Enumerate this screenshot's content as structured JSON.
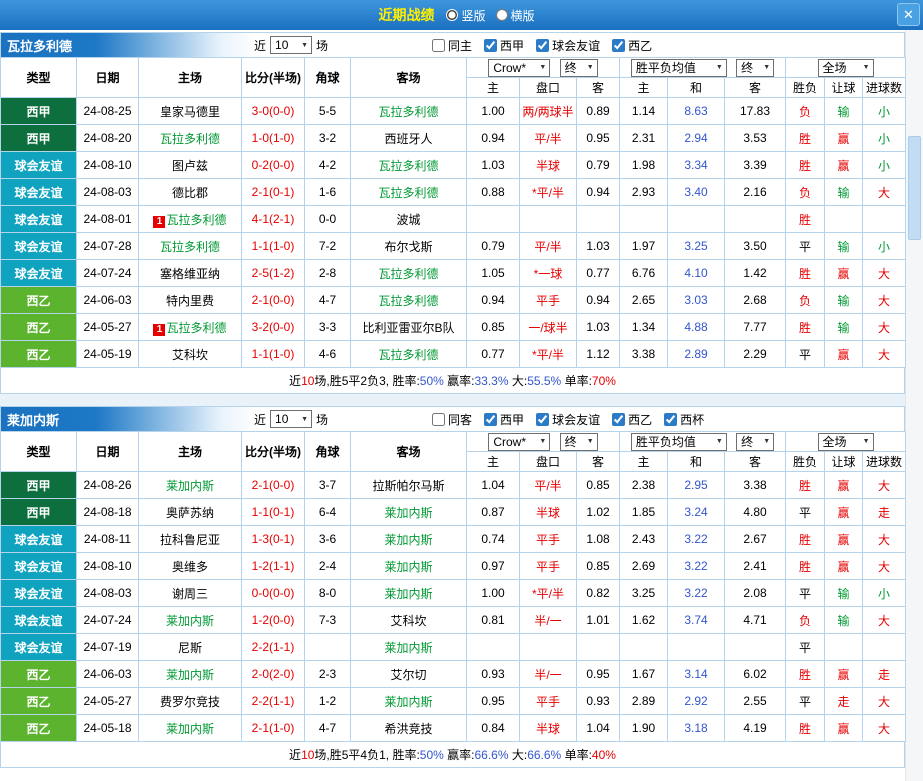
{
  "topbar": {
    "title": "近期战绩",
    "vertical": "竖版",
    "horizontal": "横版",
    "close": "✕"
  },
  "colors": {
    "score_red": "#e60000",
    "focus_green": "#009933",
    "draw_blue": "#3355cc",
    "liga_bg": "#0e6f3e",
    "friendly_bg": "#0fa3c0",
    "segunda_bg": "#5cb32e",
    "bar_blue": "#1b6fc0"
  },
  "headers": {
    "type": "类型",
    "date": "日期",
    "home": "主场",
    "score": "比分(半场)",
    "corner": "角球",
    "away": "客场",
    "h": "主",
    "line": "盘口",
    "a": "客",
    "draw": "和",
    "res": "胜负",
    "han": "让球",
    "goals": "进球数"
  },
  "sections": [
    {
      "team": "瓦拉多利德",
      "near_label": "近",
      "near_value": "10",
      "games_label": "场",
      "same_label": "同主",
      "leagues": [
        "西甲",
        "球会友谊",
        "西乙"
      ],
      "odds_dd": "Crow*",
      "end_dd": "终",
      "avg_dd": "胜平负均值",
      "scope_dd": "全场",
      "rows": [
        {
          "lg": "西甲",
          "lgc": "liga",
          "date": "24-08-25",
          "home": "皇家马德里",
          "score": "3-0(0-0)",
          "corner": "5-5",
          "away": "瓦拉多利德",
          "af": true,
          "o": [
            "1.00",
            "两/两球半",
            "0.89"
          ],
          "a": [
            "1.14",
            "8.63",
            "17.83"
          ],
          "res": [
            "负",
            "r"
          ],
          "han": [
            "输",
            "g"
          ],
          "goal": [
            "小",
            "g"
          ]
        },
        {
          "lg": "西甲",
          "lgc": "liga",
          "date": "24-08-20",
          "home": "瓦拉多利德",
          "hf": true,
          "score": "1-0(1-0)",
          "corner": "3-2",
          "away": "西班牙人",
          "o": [
            "0.94",
            "平/半",
            "0.95"
          ],
          "a": [
            "2.31",
            "2.94",
            "3.53"
          ],
          "res": [
            "胜",
            "r"
          ],
          "han": [
            "赢",
            "r"
          ],
          "goal": [
            "小",
            "g"
          ]
        },
        {
          "lg": "球会友谊",
          "lgc": "friendly",
          "date": "24-08-10",
          "home": "图卢兹",
          "score": "0-2(0-0)",
          "corner": "4-2",
          "away": "瓦拉多利德",
          "af": true,
          "o": [
            "1.03",
            "半球",
            "0.79"
          ],
          "a": [
            "1.98",
            "3.34",
            "3.39"
          ],
          "res": [
            "胜",
            "r"
          ],
          "han": [
            "赢",
            "r"
          ],
          "goal": [
            "小",
            "g"
          ]
        },
        {
          "lg": "球会友谊",
          "lgc": "friendly",
          "date": "24-08-03",
          "home": "德比郡",
          "score": "2-1(0-1)",
          "corner": "1-6",
          "away": "瓦拉多利德",
          "af": true,
          "o": [
            "0.88",
            "*平/半",
            "0.94"
          ],
          "a": [
            "2.93",
            "3.40",
            "2.16"
          ],
          "res": [
            "负",
            "r"
          ],
          "han": [
            "输",
            "g"
          ],
          "goal": [
            "大",
            "r"
          ]
        },
        {
          "lg": "球会友谊",
          "lgc": "friendly",
          "date": "24-08-01",
          "home": "瓦拉多利德",
          "hf": true,
          "hb": "1",
          "score": "4-1(2-1)",
          "corner": "0-0",
          "away": "波城",
          "o": [
            "",
            "",
            ""
          ],
          "a": [
            "",
            "",
            ""
          ],
          "res": [
            "胜",
            "r"
          ],
          "han": [
            "",
            "k"
          ],
          "goal": [
            "",
            "k"
          ]
        },
        {
          "lg": "球会友谊",
          "lgc": "friendly",
          "date": "24-07-28",
          "home": "瓦拉多利德",
          "hf": true,
          "score": "1-1(1-0)",
          "corner": "7-2",
          "away": "布尔戈斯",
          "o": [
            "0.79",
            "平/半",
            "1.03"
          ],
          "a": [
            "1.97",
            "3.25",
            "3.50"
          ],
          "res": [
            "平",
            "k"
          ],
          "han": [
            "输",
            "g"
          ],
          "goal": [
            "小",
            "g"
          ]
        },
        {
          "lg": "球会友谊",
          "lgc": "friendly",
          "date": "24-07-24",
          "home": "塞格维亚纳",
          "score": "2-5(1-2)",
          "corner": "2-8",
          "away": "瓦拉多利德",
          "af": true,
          "o": [
            "1.05",
            "*一球",
            "0.77"
          ],
          "a": [
            "6.76",
            "4.10",
            "1.42"
          ],
          "res": [
            "胜",
            "r"
          ],
          "han": [
            "赢",
            "r"
          ],
          "goal": [
            "大",
            "r"
          ]
        },
        {
          "lg": "西乙",
          "lgc": "segunda",
          "date": "24-06-03",
          "home": "特内里费",
          "score": "2-1(0-0)",
          "corner": "4-7",
          "away": "瓦拉多利德",
          "af": true,
          "o": [
            "0.94",
            "平手",
            "0.94"
          ],
          "a": [
            "2.65",
            "3.03",
            "2.68"
          ],
          "res": [
            "负",
            "r"
          ],
          "han": [
            "输",
            "g"
          ],
          "goal": [
            "大",
            "r"
          ]
        },
        {
          "lg": "西乙",
          "lgc": "segunda",
          "date": "24-05-27",
          "home": "瓦拉多利德",
          "hf": true,
          "hb": "1",
          "score": "3-2(0-0)",
          "corner": "3-3",
          "away": "比利亚雷亚尔B队",
          "o": [
            "0.85",
            "一/球半",
            "1.03"
          ],
          "a": [
            "1.34",
            "4.88",
            "7.77"
          ],
          "res": [
            "胜",
            "r"
          ],
          "han": [
            "输",
            "g"
          ],
          "goal": [
            "大",
            "r"
          ]
        },
        {
          "lg": "西乙",
          "lgc": "segunda",
          "date": "24-05-19",
          "home": "艾科坎",
          "score": "1-1(1-0)",
          "corner": "4-6",
          "away": "瓦拉多利德",
          "af": true,
          "o": [
            "0.77",
            "*平/半",
            "1.12"
          ],
          "a": [
            "3.38",
            "2.89",
            "2.29"
          ],
          "res": [
            "平",
            "k"
          ],
          "han": [
            "赢",
            "r"
          ],
          "goal": [
            "大",
            "r"
          ]
        }
      ],
      "summary": [
        {
          "t": "近",
          "c": "k"
        },
        {
          "t": "10",
          "c": "r"
        },
        {
          "t": "场,胜5平2负3, ",
          "c": "k"
        },
        {
          "t": "胜率:",
          "c": "k"
        },
        {
          "t": "50%",
          "c": "b"
        },
        {
          "t": " 赢率:",
          "c": "k"
        },
        {
          "t": "33.3%",
          "c": "b"
        },
        {
          "t": " 大:",
          "c": "k"
        },
        {
          "t": "55.5%",
          "c": "b"
        },
        {
          "t": " 单率:",
          "c": "k"
        },
        {
          "t": "70%",
          "c": "r"
        }
      ]
    },
    {
      "team": "莱加内斯",
      "near_label": "近",
      "near_value": "10",
      "games_label": "场",
      "same_label": "同客",
      "leagues": [
        "西甲",
        "球会友谊",
        "西乙",
        "西杯"
      ],
      "odds_dd": "Crow*",
      "end_dd": "终",
      "avg_dd": "胜平负均值",
      "scope_dd": "全场",
      "rows": [
        {
          "lg": "西甲",
          "lgc": "liga",
          "date": "24-08-26",
          "home": "莱加内斯",
          "hf": true,
          "score": "2-1(0-0)",
          "corner": "3-7",
          "away": "拉斯帕尔马斯",
          "o": [
            "1.04",
            "平/半",
            "0.85"
          ],
          "a": [
            "2.38",
            "2.95",
            "3.38"
          ],
          "res": [
            "胜",
            "r"
          ],
          "han": [
            "赢",
            "r"
          ],
          "goal": [
            "大",
            "r"
          ]
        },
        {
          "lg": "西甲",
          "lgc": "liga",
          "date": "24-08-18",
          "home": "奥萨苏纳",
          "score": "1-1(0-1)",
          "corner": "6-4",
          "away": "莱加内斯",
          "af": true,
          "o": [
            "0.87",
            "半球",
            "1.02"
          ],
          "a": [
            "1.85",
            "3.24",
            "4.80"
          ],
          "res": [
            "平",
            "k"
          ],
          "han": [
            "赢",
            "r"
          ],
          "goal": [
            "走",
            "r"
          ]
        },
        {
          "lg": "球会友谊",
          "lgc": "friendly",
          "date": "24-08-11",
          "home": "拉科鲁尼亚",
          "score": "1-3(0-1)",
          "corner": "3-6",
          "away": "莱加内斯",
          "af": true,
          "o": [
            "0.74",
            "平手",
            "1.08"
          ],
          "a": [
            "2.43",
            "3.22",
            "2.67"
          ],
          "res": [
            "胜",
            "r"
          ],
          "han": [
            "赢",
            "r"
          ],
          "goal": [
            "大",
            "r"
          ]
        },
        {
          "lg": "球会友谊",
          "lgc": "friendly",
          "date": "24-08-10",
          "home": "奥维多",
          "score": "1-2(1-1)",
          "corner": "2-4",
          "away": "莱加内斯",
          "af": true,
          "o": [
            "0.97",
            "平手",
            "0.85"
          ],
          "a": [
            "2.69",
            "3.22",
            "2.41"
          ],
          "res": [
            "胜",
            "r"
          ],
          "han": [
            "赢",
            "r"
          ],
          "goal": [
            "大",
            "r"
          ]
        },
        {
          "lg": "球会友谊",
          "lgc": "friendly",
          "date": "24-08-03",
          "home": "谢周三",
          "score": "0-0(0-0)",
          "corner": "8-0",
          "away": "莱加内斯",
          "af": true,
          "o": [
            "1.00",
            "*平/半",
            "0.82"
          ],
          "a": [
            "3.25",
            "3.22",
            "2.08"
          ],
          "res": [
            "平",
            "k"
          ],
          "han": [
            "输",
            "g"
          ],
          "goal": [
            "小",
            "g"
          ]
        },
        {
          "lg": "球会友谊",
          "lgc": "friendly",
          "date": "24-07-24",
          "home": "莱加内斯",
          "hf": true,
          "score": "1-2(0-0)",
          "corner": "7-3",
          "away": "艾科坎",
          "o": [
            "0.81",
            "半/一",
            "1.01"
          ],
          "a": [
            "1.62",
            "3.74",
            "4.71"
          ],
          "res": [
            "负",
            "r"
          ],
          "han": [
            "输",
            "g"
          ],
          "goal": [
            "大",
            "r"
          ]
        },
        {
          "lg": "球会友谊",
          "lgc": "friendly",
          "date": "24-07-19",
          "home": "尼斯",
          "score": "2-2(1-1)",
          "corner": "",
          "away": "莱加内斯",
          "af": true,
          "o": [
            "",
            "",
            ""
          ],
          "a": [
            "",
            "",
            ""
          ],
          "res": [
            "平",
            "k"
          ],
          "han": [
            "",
            "k"
          ],
          "goal": [
            "",
            "k"
          ]
        },
        {
          "lg": "西乙",
          "lgc": "segunda",
          "date": "24-06-03",
          "home": "莱加内斯",
          "hf": true,
          "score": "2-0(2-0)",
          "corner": "2-3",
          "away": "艾尔切",
          "o": [
            "0.93",
            "半/一",
            "0.95"
          ],
          "a": [
            "1.67",
            "3.14",
            "6.02"
          ],
          "res": [
            "胜",
            "r"
          ],
          "han": [
            "赢",
            "r"
          ],
          "goal": [
            "走",
            "r"
          ]
        },
        {
          "lg": "西乙",
          "lgc": "segunda",
          "date": "24-05-27",
          "home": "费罗尔竞技",
          "score": "2-2(1-1)",
          "corner": "1-2",
          "away": "莱加内斯",
          "af": true,
          "o": [
            "0.95",
            "平手",
            "0.93"
          ],
          "a": [
            "2.89",
            "2.92",
            "2.55"
          ],
          "res": [
            "平",
            "k"
          ],
          "han": [
            "走",
            "r"
          ],
          "goal": [
            "大",
            "r"
          ]
        },
        {
          "lg": "西乙",
          "lgc": "segunda",
          "date": "24-05-18",
          "home": "莱加内斯",
          "hf": true,
          "score": "2-1(1-0)",
          "corner": "4-7",
          "away": "希洪竞技",
          "o": [
            "0.84",
            "半球",
            "1.04"
          ],
          "a": [
            "1.90",
            "3.18",
            "4.19"
          ],
          "res": [
            "胜",
            "r"
          ],
          "han": [
            "赢",
            "r"
          ],
          "goal": [
            "大",
            "r"
          ]
        }
      ],
      "summary": [
        {
          "t": "近",
          "c": "k"
        },
        {
          "t": "10",
          "c": "r"
        },
        {
          "t": "场,胜5平4负1, ",
          "c": "k"
        },
        {
          "t": "胜率:",
          "c": "k"
        },
        {
          "t": "50%",
          "c": "b"
        },
        {
          "t": " 赢率:",
          "c": "k"
        },
        {
          "t": "66.6%",
          "c": "b"
        },
        {
          "t": " 大:",
          "c": "k"
        },
        {
          "t": "66.6%",
          "c": "b"
        },
        {
          "t": " 单率:",
          "c": "k"
        },
        {
          "t": "40%",
          "c": "r"
        }
      ]
    }
  ]
}
